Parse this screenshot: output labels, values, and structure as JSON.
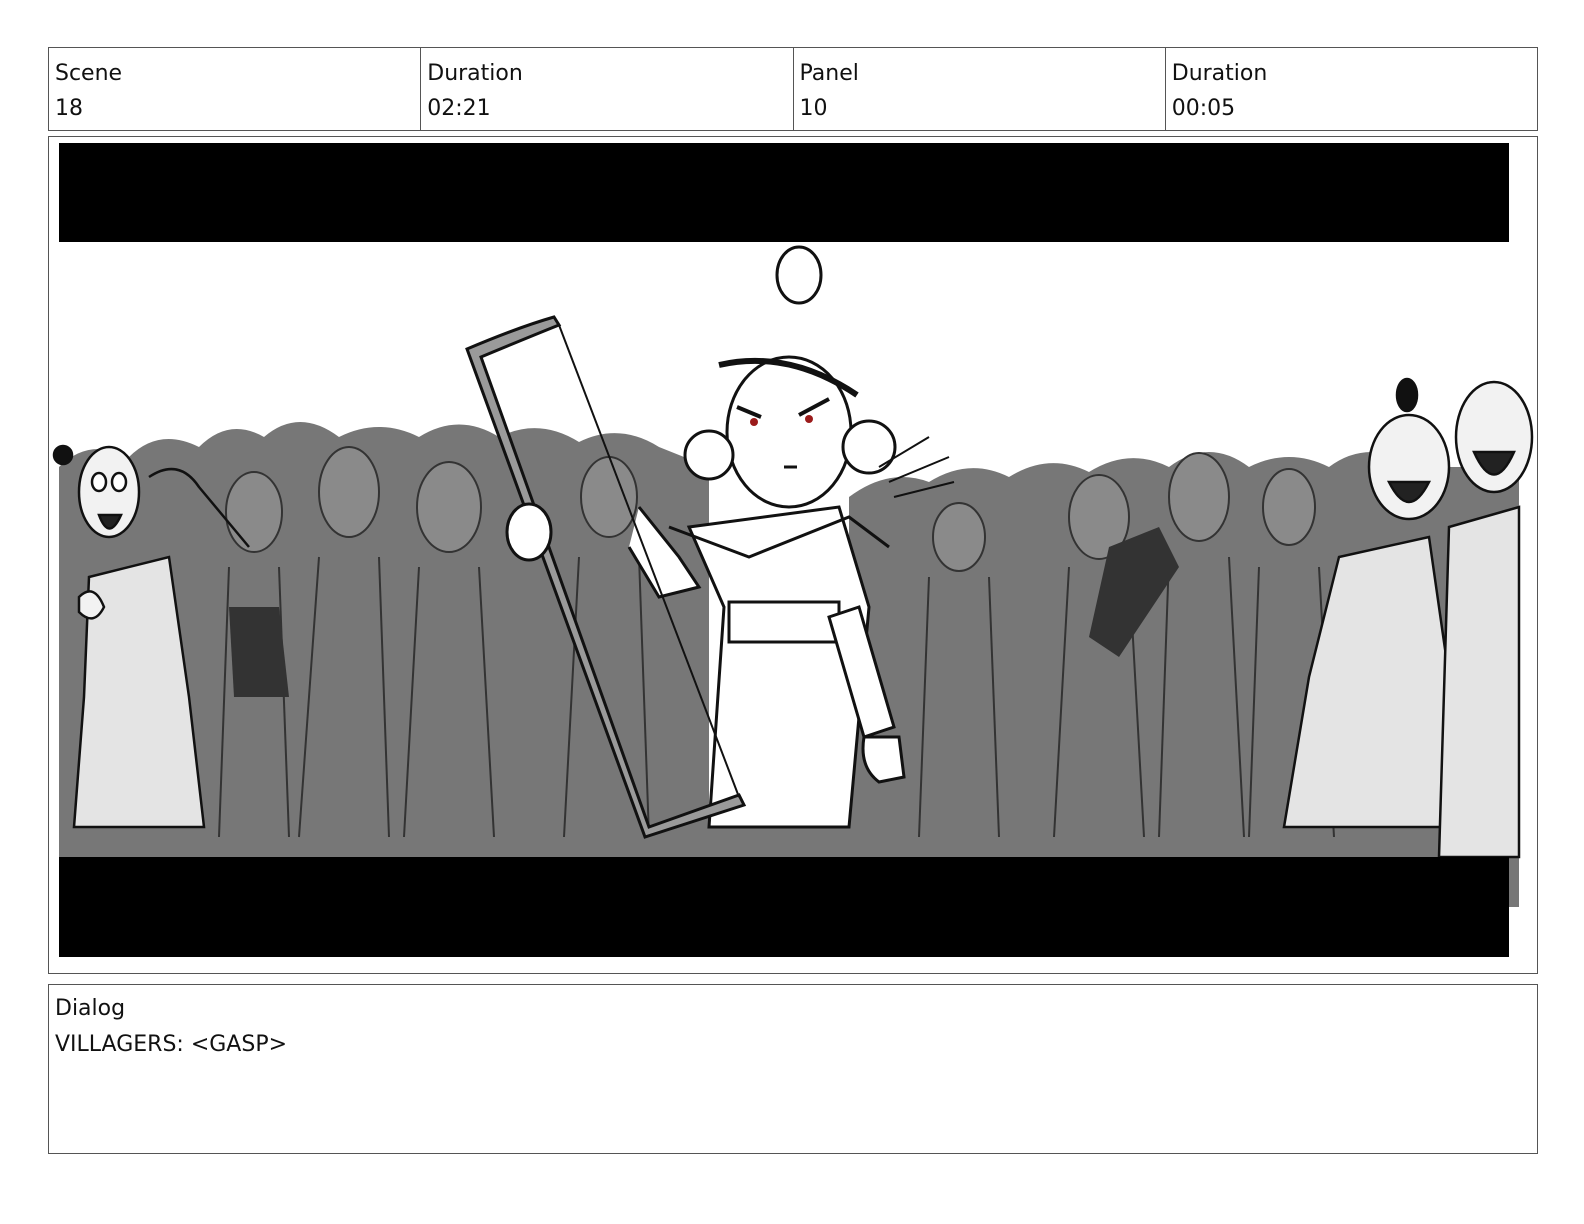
{
  "header": {
    "cells": [
      {
        "label": "Scene",
        "value": "18"
      },
      {
        "label": "Duration",
        "value": "02:21"
      },
      {
        "label": "Panel",
        "value": "10"
      },
      {
        "label": "Duration",
        "value": "00:05"
      }
    ]
  },
  "panel": {
    "letterbox_color": "#000000",
    "crowd_color": "#777777",
    "foreground_fill": "#e4e4e4",
    "eye_color": "#9b1b1b"
  },
  "dialog": {
    "label": "Dialog",
    "text": "VILLAGERS: <GASP>"
  }
}
